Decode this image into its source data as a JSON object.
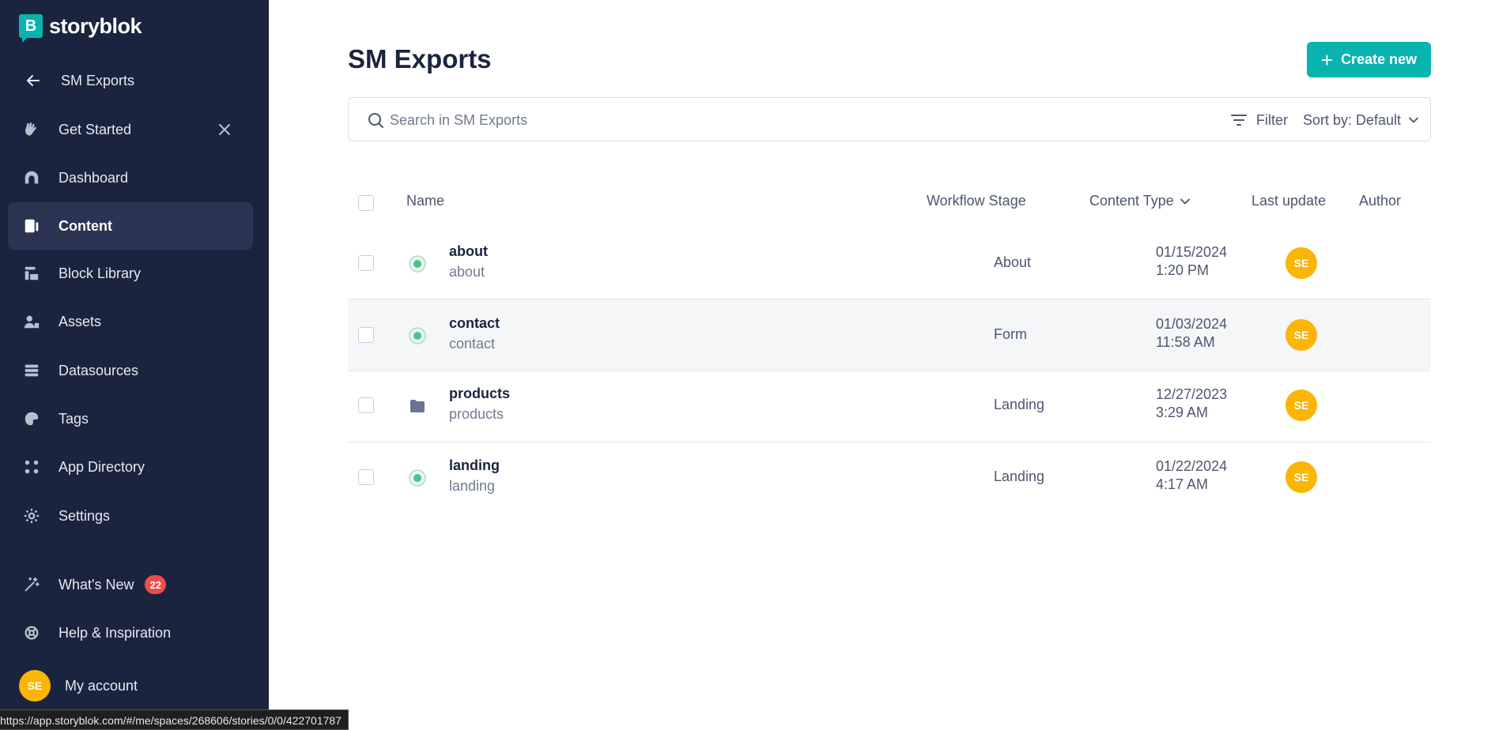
{
  "sidebar": {
    "brand": "storyblok",
    "back_label": "SM Exports",
    "items": [
      {
        "label": "Get Started",
        "icon": "wave-hand-icon"
      },
      {
        "label": "Dashboard",
        "icon": "dashboard-icon"
      },
      {
        "label": "Content",
        "icon": "content-icon",
        "active": true
      },
      {
        "label": "Block Library",
        "icon": "blocks-icon"
      },
      {
        "label": "Assets",
        "icon": "assets-icon"
      },
      {
        "label": "Datasources",
        "icon": "datasources-icon"
      },
      {
        "label": "Tags",
        "icon": "tag-icon"
      },
      {
        "label": "App Directory",
        "icon": "apps-icon"
      },
      {
        "label": "Settings",
        "icon": "gear-icon"
      }
    ],
    "whats_new": {
      "label": "What's New",
      "count": "22"
    },
    "help_label": "Help & Inspiration",
    "account": {
      "initials": "SE",
      "label": "My account"
    }
  },
  "status_url": "https://app.storyblok.com/#/me/spaces/268606/stories/0/0/422701787",
  "main": {
    "title": "SM Exports",
    "create_label": "Create new",
    "search_placeholder": "Search in SM Exports",
    "filter_label": "Filter",
    "sort_label": "Sort by: Default",
    "columns": {
      "name": "Name",
      "workflow": "Workflow Stage",
      "content_type": "Content Type",
      "last_update": "Last update",
      "author": "Author"
    },
    "rows": [
      {
        "name": "about",
        "slug": "about",
        "type": "About",
        "date": "01/15/2024",
        "time": "1:20 PM",
        "author": "SE",
        "kind": "story"
      },
      {
        "name": "contact",
        "slug": "contact",
        "type": "Form",
        "date": "01/03/2024",
        "time": "11:58 AM",
        "author": "SE",
        "kind": "story"
      },
      {
        "name": "products",
        "slug": "products",
        "type": "Landing",
        "date": "12/27/2023",
        "time": "3:29 AM",
        "author": "SE",
        "kind": "folder"
      },
      {
        "name": "landing",
        "slug": "landing",
        "type": "Landing",
        "date": "01/22/2024",
        "time": "4:17 AM",
        "author": "SE",
        "kind": "story"
      }
    ]
  },
  "colors": {
    "sidebar_bg": "#1b243f",
    "accent": "#09b3af",
    "avatar": "#fbb505",
    "badge": "#ef4c4c",
    "published": "#4fc08d"
  }
}
